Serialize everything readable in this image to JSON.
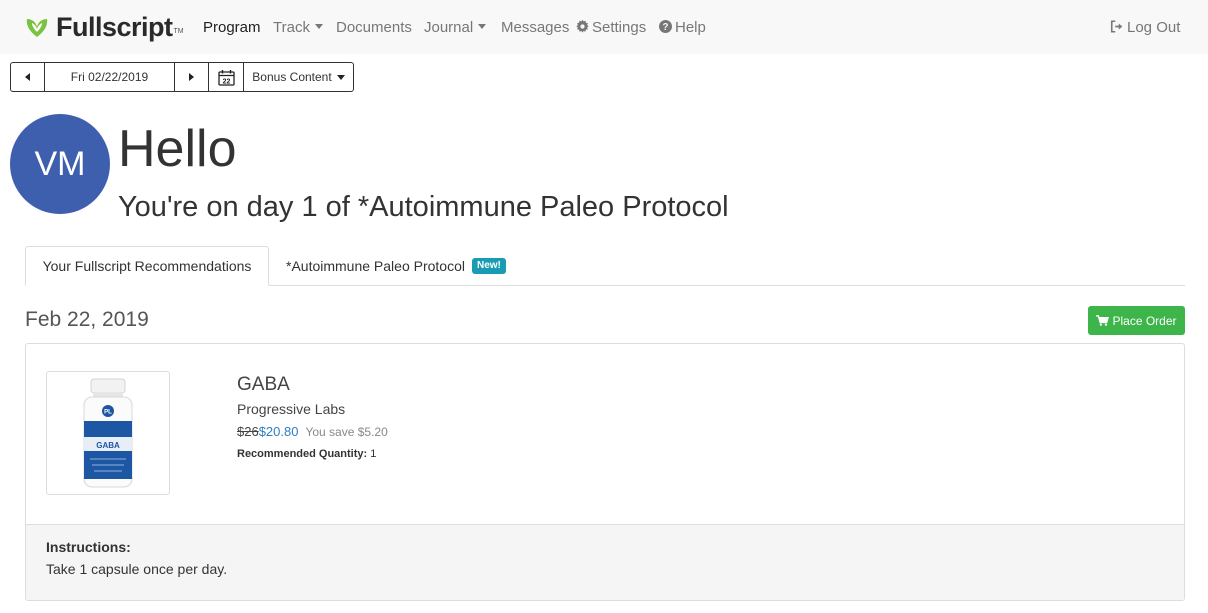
{
  "brand": {
    "name": "Fullscript",
    "tm": "TM",
    "color": "#7cc242"
  },
  "nav": {
    "program": "Program",
    "track": "Track",
    "documents": "Documents",
    "journal": "Journal",
    "messages": "Messages",
    "settings": "Settings",
    "help": "Help",
    "logout": "Log Out"
  },
  "toolbar": {
    "date": "Fri 02/22/2019",
    "calendar_day": "22",
    "bonus": "Bonus Content"
  },
  "greeting": {
    "initials": "VM",
    "avatar_color": "#3e5fae",
    "hello": "Hello",
    "subtitle": "You're on day 1 of *Autoimmune Paleo Protocol"
  },
  "tabs": [
    {
      "label": "Your Fullscript Recommendations",
      "active": true
    },
    {
      "label": "*Autoimmune Paleo Protocol",
      "badge": "New!"
    }
  ],
  "section": {
    "date": "Feb 22, 2019",
    "order_button": "Place Order",
    "order_color": "#3db54a"
  },
  "product": {
    "name": "GABA",
    "brand": "Progressive Labs",
    "old_price": "$26",
    "new_price": "$20.80",
    "savings": "You save $5.20",
    "qty_label": "Recommended Quantity:",
    "qty_value": "1",
    "bottle_label": "GABA",
    "bottle_logo": "PL"
  },
  "instructions": {
    "label": "Instructions:",
    "text": "Take 1 capsule once per day."
  }
}
